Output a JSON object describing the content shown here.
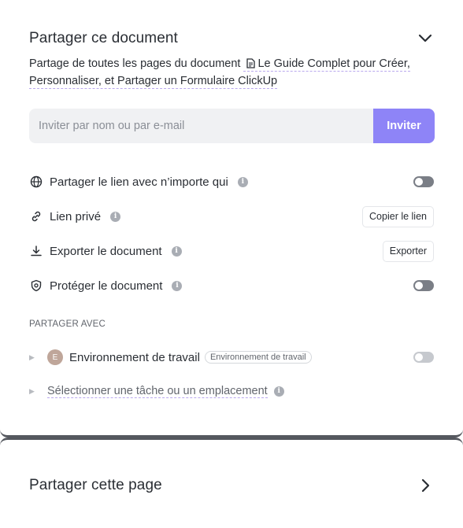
{
  "share_document": {
    "title": "Partager ce document",
    "description_prefix": "Partage de toutes les pages du document",
    "document_name": "Le Guide Complet pour Créer, Personnaliser, et Partager un Formulaire ClickUp"
  },
  "invite": {
    "placeholder": "Inviter par nom ou par e-mail",
    "button_label": "Inviter"
  },
  "options": {
    "public_link": {
      "label": "Partager le lien avec n’importe qui",
      "enabled": false
    },
    "private_link": {
      "label": "Lien privé",
      "button_label": "Copier le lien"
    },
    "export": {
      "label": "Exporter le document",
      "button_label": "Exporter"
    },
    "protect": {
      "label": "Protéger le document",
      "enabled": false
    }
  },
  "share_with": {
    "section_label": "PARTAGER AVEC",
    "workspace": {
      "avatar_initial": "E",
      "name": "Environnement de travail",
      "badge": "Environnement de travail",
      "enabled": false
    },
    "select_location_label": "Sélectionner une tâche ou un emplacement"
  },
  "share_page": {
    "title": "Partager cette page"
  },
  "colors": {
    "accent": "#8e84f7",
    "toggle_off": "#7a7e86",
    "divider": "#55585f"
  }
}
